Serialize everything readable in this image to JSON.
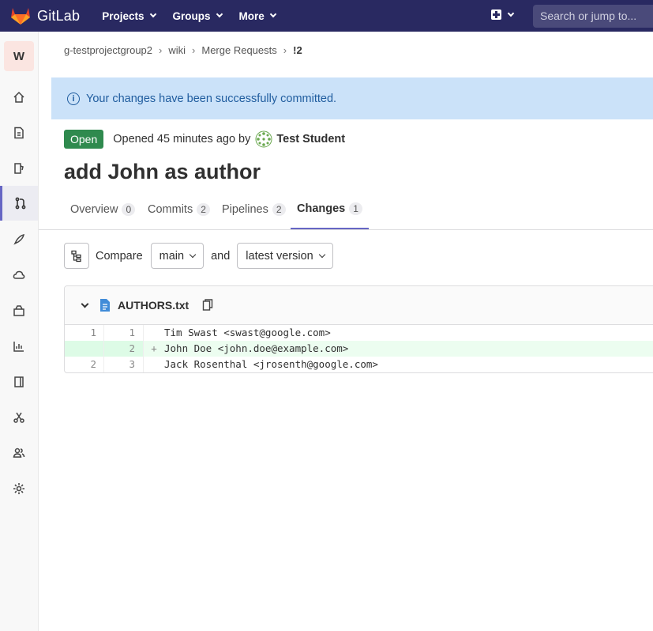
{
  "navbar": {
    "brand": "GitLab",
    "menu": [
      {
        "label": "Projects"
      },
      {
        "label": "Groups"
      },
      {
        "label": "More"
      }
    ],
    "search_placeholder": "Search or jump to..."
  },
  "sidebar": {
    "project_initial": "W",
    "items": [
      {
        "icon": "home-icon"
      },
      {
        "icon": "document-icon"
      },
      {
        "icon": "issues-icon"
      },
      {
        "icon": "merge-request-icon",
        "active": true
      },
      {
        "icon": "rocket-icon"
      },
      {
        "icon": "cloud-icon"
      },
      {
        "icon": "package-icon"
      },
      {
        "icon": "analytics-icon"
      },
      {
        "icon": "book-icon"
      },
      {
        "icon": "scissors-icon"
      },
      {
        "icon": "members-icon"
      },
      {
        "icon": "settings-icon"
      }
    ]
  },
  "breadcrumb": [
    "g-testprojectgroup2",
    "wiki",
    "Merge Requests",
    "!2"
  ],
  "alert": {
    "text": "Your changes have been successfully committed."
  },
  "mr": {
    "status": "Open",
    "opened_text": "Opened 45 minutes ago by",
    "author": "Test Student",
    "title": "add John as author"
  },
  "tabs": [
    {
      "label": "Overview",
      "count": "0"
    },
    {
      "label": "Commits",
      "count": "2"
    },
    {
      "label": "Pipelines",
      "count": "2"
    },
    {
      "label": "Changes",
      "count": "1",
      "active": true
    }
  ],
  "compare": {
    "label": "Compare",
    "base": "main",
    "and": "and",
    "target": "latest version"
  },
  "diff": {
    "file_name": "AUTHORS.txt",
    "lines": [
      {
        "old": "1",
        "new": "1",
        "sign": "",
        "text": "Tim Swast <swast@google.com>",
        "type": "context"
      },
      {
        "old": "",
        "new": "2",
        "sign": "+",
        "text": "John Doe <john.doe@example.com>",
        "type": "added"
      },
      {
        "old": "2",
        "new": "3",
        "sign": "",
        "text": "Jack Rosenthal <jrosenth@google.com>",
        "type": "context"
      }
    ]
  },
  "colors": {
    "navbar": "#292961",
    "alert_bg": "#cbe2f9",
    "open_badge": "#2f8a4e",
    "active_tab": "#6666c4",
    "added_line": "#ecfdf0"
  }
}
